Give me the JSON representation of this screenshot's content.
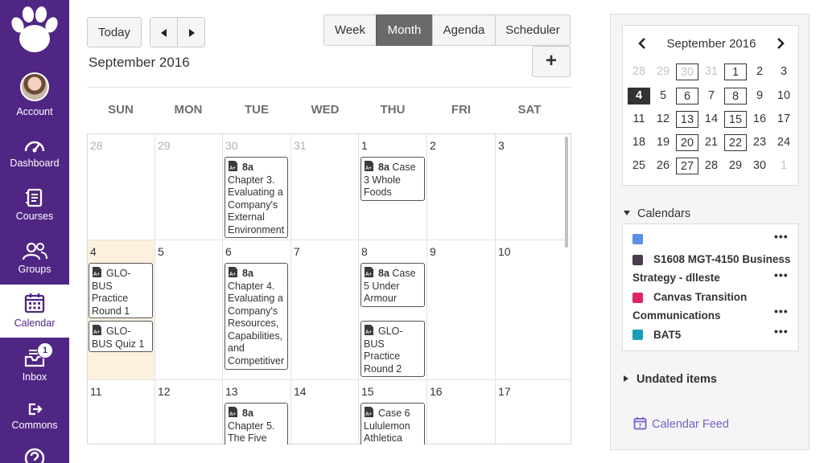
{
  "nav": {
    "items": [
      {
        "label": "Account",
        "icon": "avatar"
      },
      {
        "label": "Dashboard",
        "icon": "dashboard-icon"
      },
      {
        "label": "Courses",
        "icon": "courses-icon"
      },
      {
        "label": "Groups",
        "icon": "groups-icon"
      },
      {
        "label": "Calendar",
        "icon": "calendar-icon",
        "active": true
      },
      {
        "label": "Inbox",
        "icon": "inbox-icon",
        "badge": "1"
      },
      {
        "label": "Commons",
        "icon": "commons-icon"
      }
    ],
    "colors": {
      "brand": "#4f2683",
      "brand_logo": "#ffffff"
    }
  },
  "toolbar": {
    "today": "Today",
    "views": [
      "Week",
      "Month",
      "Agenda",
      "Scheduler"
    ],
    "active_view": "Month",
    "add": "+"
  },
  "month_title": "September 2016",
  "weekdays": [
    "SUN",
    "MON",
    "TUE",
    "WED",
    "THU",
    "FRI",
    "SAT"
  ],
  "weeks": [
    [
      {
        "d": "28",
        "other": true
      },
      {
        "d": "29",
        "other": true
      },
      {
        "d": "30",
        "other": true
      },
      {
        "d": "31",
        "other": true
      },
      {
        "d": "1"
      },
      {
        "d": "2"
      },
      {
        "d": "3"
      }
    ],
    [
      {
        "d": "4",
        "today": true
      },
      {
        "d": "5"
      },
      {
        "d": "6"
      },
      {
        "d": "7"
      },
      {
        "d": "8"
      },
      {
        "d": "9"
      },
      {
        "d": "10"
      }
    ],
    [
      {
        "d": "11"
      },
      {
        "d": "12"
      },
      {
        "d": "13"
      },
      {
        "d": "14"
      },
      {
        "d": "15"
      },
      {
        "d": "16"
      },
      {
        "d": "17"
      }
    ]
  ],
  "events": {
    "e1": {
      "time": "8a",
      "title": "Chapter 3. Evaluating a Company's External Environment"
    },
    "e2": {
      "time": "8a",
      "title": "Case 3 Whole Foods"
    },
    "e3": {
      "time": "",
      "title": "GLO-BUS Practice Round 1"
    },
    "e4": {
      "time": "",
      "title": "GLO-BUS Quiz 1"
    },
    "e5": {
      "time": "8a",
      "title": "Chapter 4. Evaluating a Company's Resources, Capabilities, and Competitiver"
    },
    "e6": {
      "time": "8a",
      "title": "Case 5 Under Armour"
    },
    "e7": {
      "time": "",
      "title": "GLO-BUS Practice Round 2"
    },
    "e8": {
      "time": "8a",
      "title": "Chapter 5. The Five"
    },
    "e9": {
      "time": "",
      "title": "Case 6 Lululemon Athletica"
    }
  },
  "mini_cal": {
    "title": "September 2016",
    "days": [
      [
        {
          "d": "28",
          "other": true
        },
        {
          "d": "29",
          "other": true
        },
        {
          "d": "30",
          "other": true,
          "boxed": true
        },
        {
          "d": "31",
          "other": true
        },
        {
          "d": "1",
          "boxed": true
        },
        {
          "d": "2"
        },
        {
          "d": "3"
        }
      ],
      [
        {
          "d": "4",
          "sel": true
        },
        {
          "d": "5"
        },
        {
          "d": "6",
          "boxed": true
        },
        {
          "d": "7"
        },
        {
          "d": "8",
          "boxed": true
        },
        {
          "d": "9"
        },
        {
          "d": "10"
        }
      ],
      [
        {
          "d": "11"
        },
        {
          "d": "12"
        },
        {
          "d": "13",
          "boxed": true
        },
        {
          "d": "14"
        },
        {
          "d": "15",
          "boxed": true
        },
        {
          "d": "16"
        },
        {
          "d": "17"
        }
      ],
      [
        {
          "d": "18"
        },
        {
          "d": "19"
        },
        {
          "d": "20",
          "boxed": true
        },
        {
          "d": "21"
        },
        {
          "d": "22",
          "boxed": true
        },
        {
          "d": "23"
        },
        {
          "d": "24"
        }
      ],
      [
        {
          "d": "25"
        },
        {
          "d": "26"
        },
        {
          "d": "27",
          "boxed": true
        },
        {
          "d": "28"
        },
        {
          "d": "29"
        },
        {
          "d": "30"
        },
        {
          "d": "1",
          "other": true
        }
      ]
    ]
  },
  "calendars": {
    "heading": "Calendars",
    "items": [
      {
        "name": "",
        "color": "#5b8ee6"
      },
      {
        "name_line1": "S1608 MGT-4150 Business",
        "name_line2": "Strategy - dlleste",
        "color": "#4a3d4f"
      },
      {
        "name_line1": "Canvas Transition",
        "name_line2": "Communications",
        "color": "#e0245e"
      },
      {
        "name": "BAT5",
        "color": "#1a9db8"
      }
    ],
    "more": "•••"
  },
  "undated": "Undated items",
  "feed": "Calendar Feed"
}
